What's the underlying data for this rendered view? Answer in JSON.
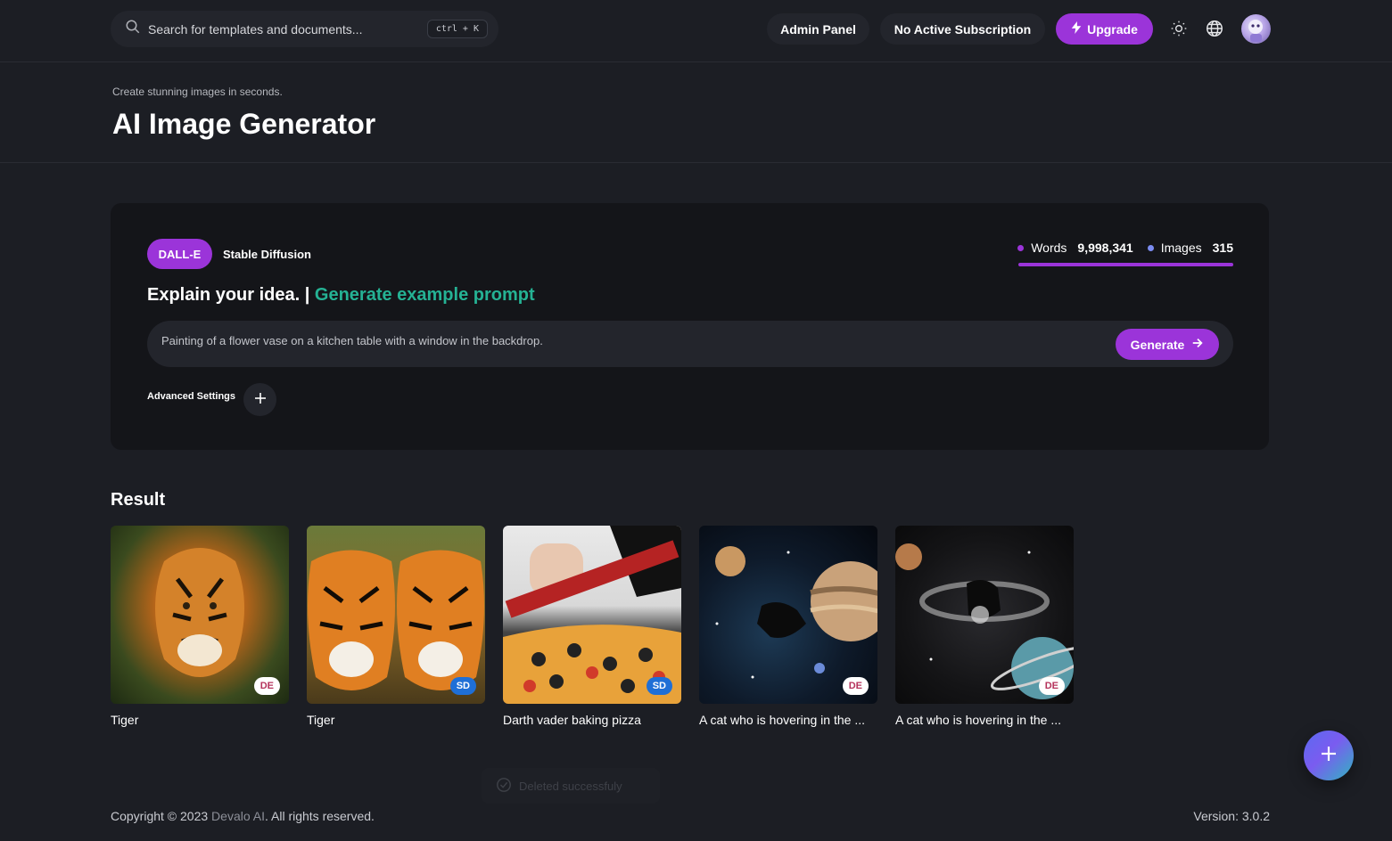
{
  "topbar": {
    "search_placeholder": "Search for templates and documents...",
    "search_shortcut": "ctrl + K",
    "admin_label": "Admin Panel",
    "subscription_label": "No Active Subscription",
    "upgrade_label": "Upgrade"
  },
  "header": {
    "subtitle": "Create stunning images in seconds.",
    "title": "AI Image Generator"
  },
  "generator": {
    "tabs": [
      "DALL-E",
      "Stable Diffusion"
    ],
    "active_tab": "DALL-E",
    "stats": {
      "words_label": "Words",
      "words_value": "9,998,341",
      "images_label": "Images",
      "images_value": "315"
    },
    "explain_label": "Explain your idea. |",
    "example_link": "Generate example prompt",
    "prompt_placeholder": "Painting of a flower vase on a kitchen table with a window in the backdrop.",
    "generate_label": "Generate",
    "advanced_label": "Advanced Settings"
  },
  "results": {
    "title": "Result",
    "items": [
      {
        "caption": "Tiger",
        "badge": "DE"
      },
      {
        "caption": "Tiger",
        "badge": "SD"
      },
      {
        "caption": "Darth vader baking pizza",
        "badge": "SD"
      },
      {
        "caption": "A cat who is hovering in the ...",
        "badge": "DE"
      },
      {
        "caption": "A cat who is hovering in the ...",
        "badge": "DE"
      }
    ]
  },
  "toast": {
    "message": "Deleted successfuly"
  },
  "footer": {
    "copyright_prefix": "Copyright © 2023",
    "brand": "Devalo AI",
    "copyright_suffix": ". All rights reserved.",
    "version": "Version: 3.0.2"
  },
  "colors": {
    "accent": "#9b34d9",
    "link": "#25b294",
    "background": "#1c1e24",
    "card": "#141519"
  }
}
